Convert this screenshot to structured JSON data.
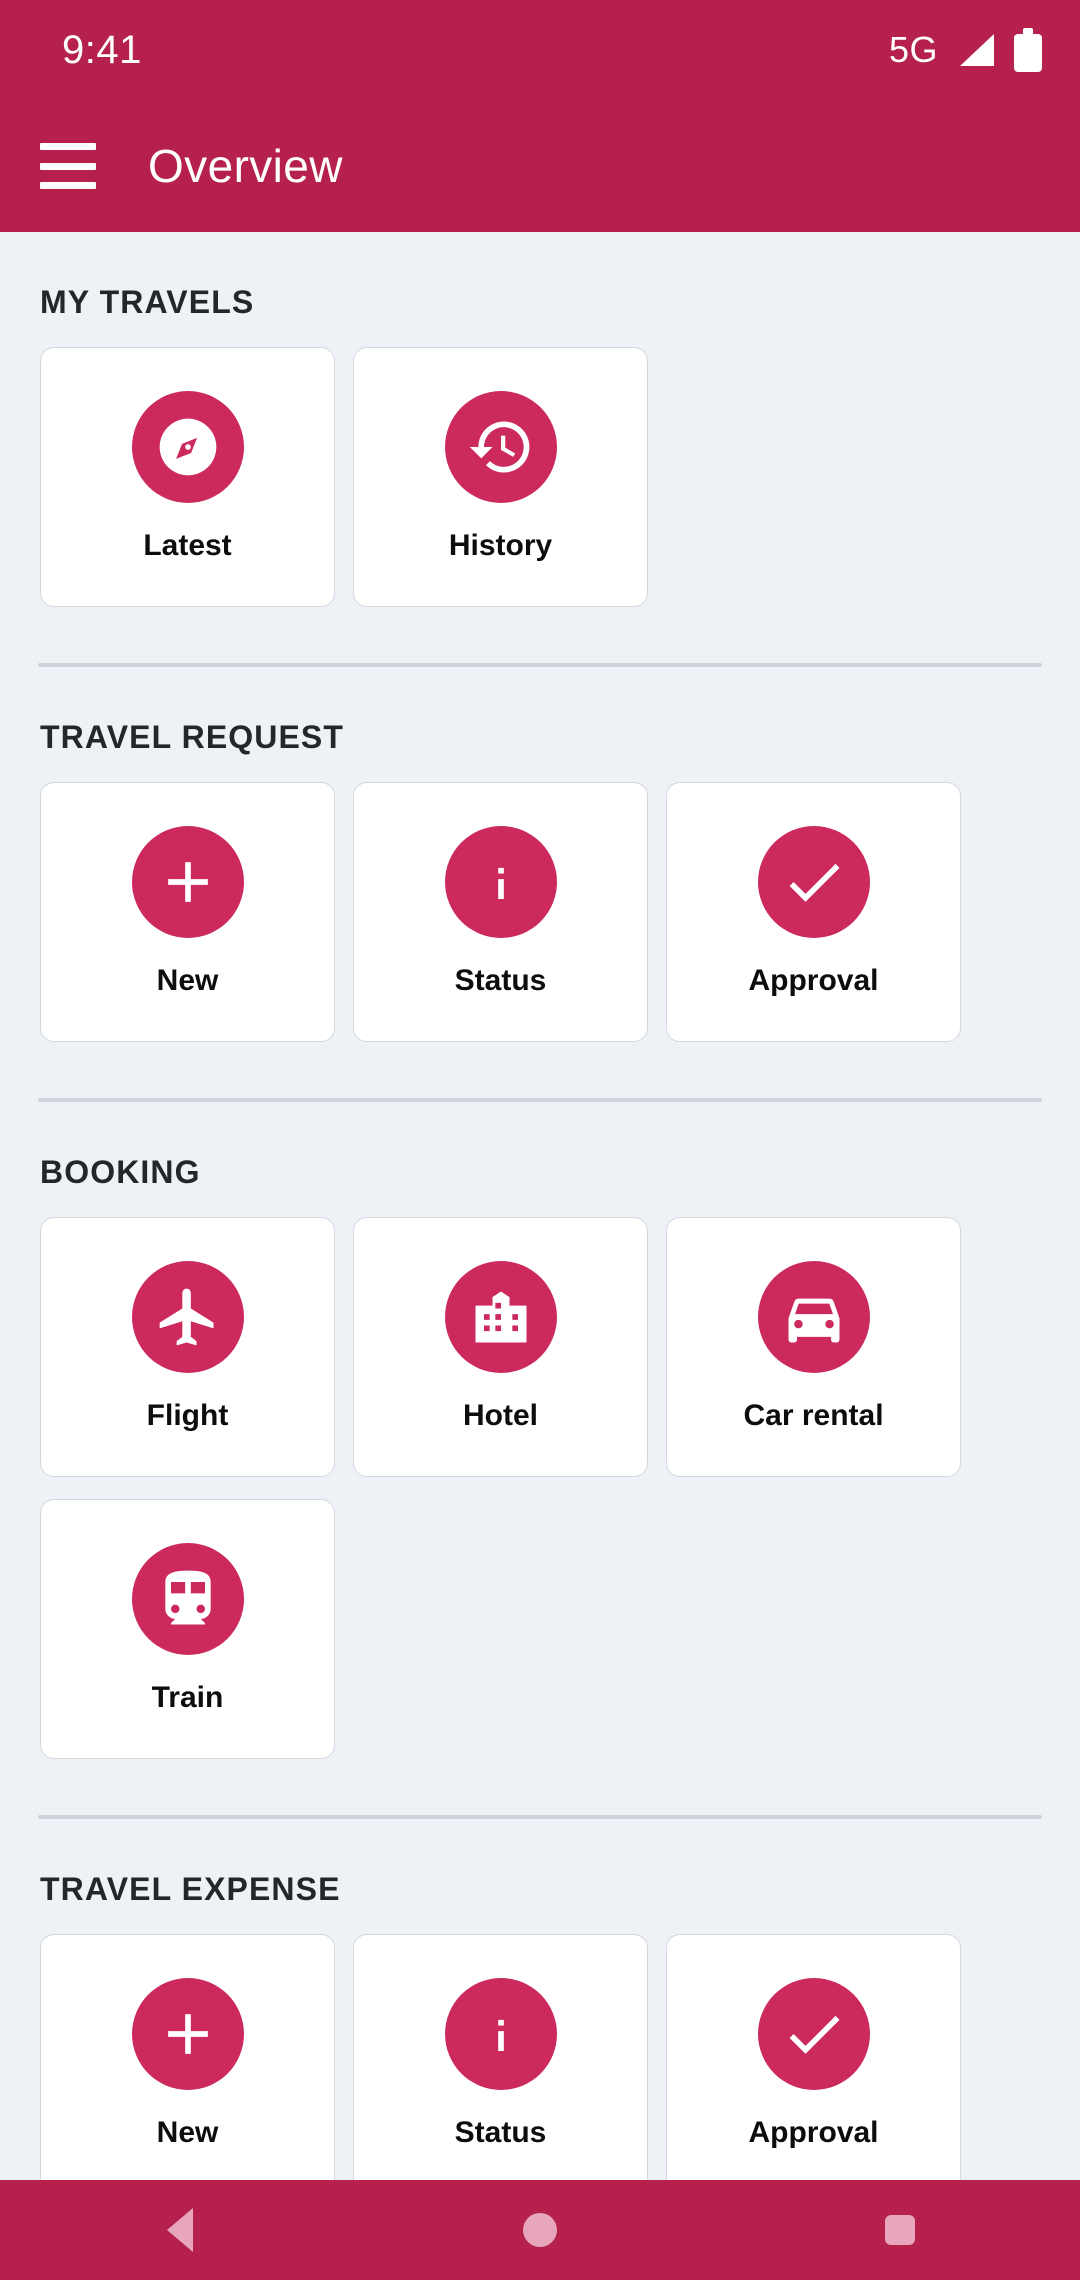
{
  "status_bar": {
    "clock": "9:41",
    "network": "5G",
    "signal_icon": "signal-bars-icon",
    "battery_icon": "battery-full-icon"
  },
  "app_bar": {
    "menu_icon": "hamburger-menu-icon",
    "title": "Overview"
  },
  "theme": {
    "header_color": "#B5204D",
    "accent_color": "#CC2A5D",
    "page_background": "#EEF1F6",
    "card_background": "#FFFFFF",
    "card_border": "#D4D8DF",
    "divider_color": "#CFD4DC",
    "nav_icon_color": "#E8A6BC"
  },
  "sections": [
    {
      "title": "MY TRAVELS",
      "items": [
        {
          "label": "Latest",
          "icon": "compass-icon"
        },
        {
          "label": "History",
          "icon": "history-clock-icon"
        }
      ]
    },
    {
      "title": "TRAVEL REQUEST",
      "items": [
        {
          "label": "New",
          "icon": "plus-icon"
        },
        {
          "label": "Status",
          "icon": "info-icon"
        },
        {
          "label": "Approval",
          "icon": "check-icon"
        }
      ]
    },
    {
      "title": "BOOKING",
      "items": [
        {
          "label": "Flight",
          "icon": "airplane-icon"
        },
        {
          "label": "Hotel",
          "icon": "hotel-building-icon"
        },
        {
          "label": "Car rental",
          "icon": "car-icon"
        },
        {
          "label": "Train",
          "icon": "train-icon"
        }
      ]
    },
    {
      "title": "TRAVEL EXPENSE",
      "items": [
        {
          "label": "New",
          "icon": "plus-icon"
        },
        {
          "label": "Status",
          "icon": "info-icon"
        },
        {
          "label": "Approval",
          "icon": "check-icon"
        }
      ]
    }
  ],
  "nav_bar": {
    "back_icon": "back-triangle-icon",
    "home_icon": "home-circle-icon",
    "recents_icon": "recents-square-icon"
  }
}
